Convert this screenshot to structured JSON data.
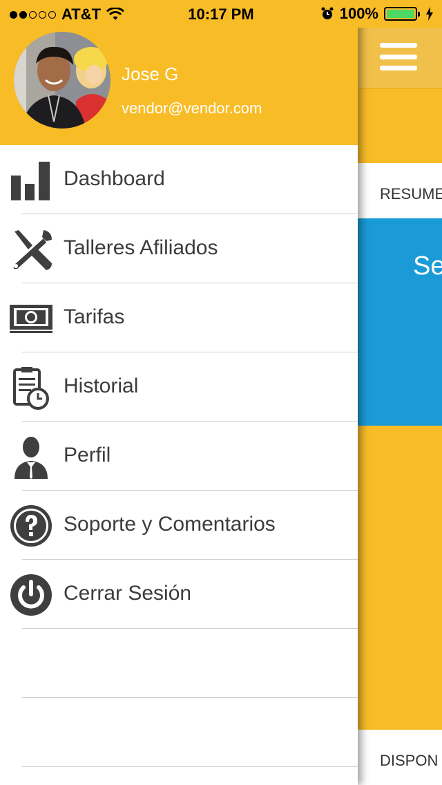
{
  "status_bar": {
    "carrier": "AT&T",
    "time": "10:17 PM",
    "battery": "100%",
    "battery_level": 1.0,
    "icons": [
      "signal-dots",
      "wifi-icon",
      "alarm-icon",
      "battery-icon",
      "charging-icon"
    ]
  },
  "drawer": {
    "user": {
      "name": "Jose G",
      "email": "vendor@vendor.com"
    },
    "menu": [
      {
        "label": "Dashboard",
        "icon": "bar-chart-icon"
      },
      {
        "label": "Talleres Afiliados",
        "icon": "tools-icon"
      },
      {
        "label": "Tarifas",
        "icon": "money-icon"
      },
      {
        "label": "Historial",
        "icon": "clipboard-clock-icon"
      },
      {
        "label": "Perfil",
        "icon": "person-icon"
      },
      {
        "label": "Soporte y Comentarios",
        "icon": "question-icon"
      },
      {
        "label": "Cerrar Sesión",
        "icon": "power-icon"
      }
    ]
  },
  "background": {
    "resumen_label": "RESUMEN",
    "card_text": "Se",
    "dispon_label": "DISPON"
  },
  "colors": {
    "accent": "#f8bc27",
    "blue": "#1a9bd7",
    "text": "#3c3c3c",
    "icon": "#3f3f3f"
  }
}
